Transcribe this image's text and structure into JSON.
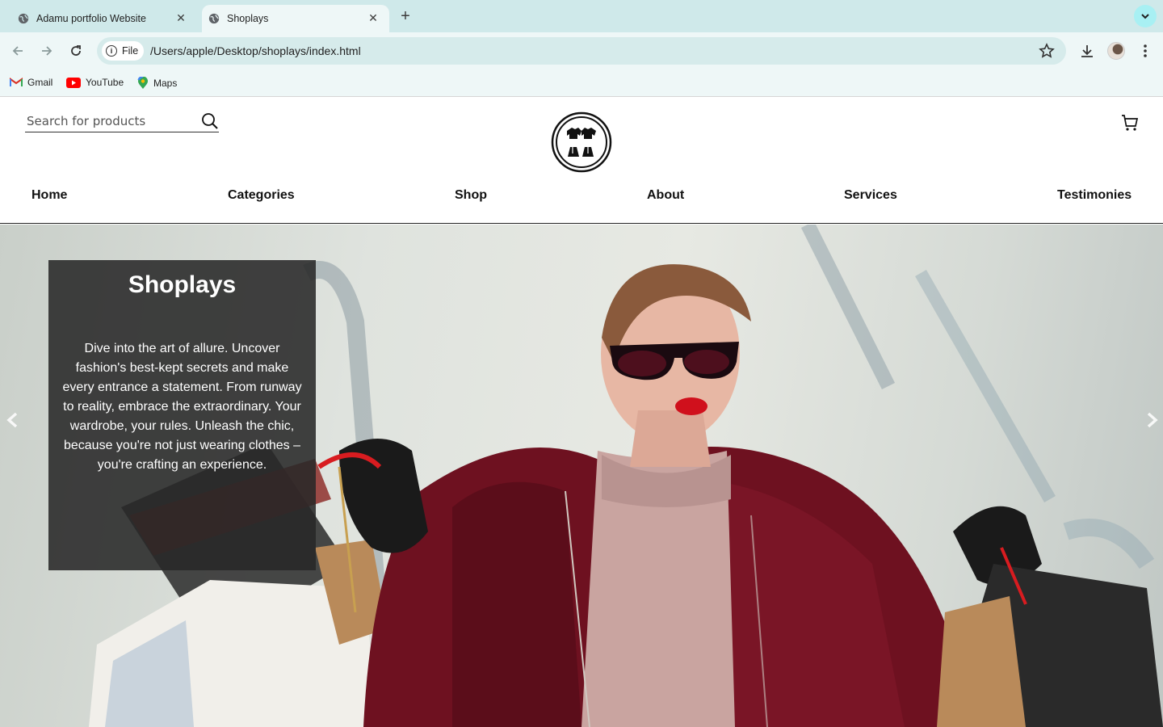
{
  "browser": {
    "tabs": [
      {
        "title": "Adamu portfolio Website"
      },
      {
        "title": "Shoplays"
      }
    ],
    "address": {
      "scheme_label": "File",
      "url": "/Users/apple/Desktop/shoplays/index.html"
    },
    "bookmarks": [
      {
        "label": "Gmail"
      },
      {
        "label": "YouTube"
      },
      {
        "label": "Maps"
      }
    ],
    "accent_color": "#cfe9ea"
  },
  "site": {
    "search": {
      "placeholder": "Search for products"
    },
    "nav": [
      {
        "label": "Home"
      },
      {
        "label": "Categories"
      },
      {
        "label": "Shop"
      },
      {
        "label": "About"
      },
      {
        "label": "Services"
      },
      {
        "label": "Testimonies"
      }
    ],
    "hero": {
      "title": "Shoplays",
      "text": "Dive into the art of allure. Uncover fashion's best-kept secrets and make every entrance a statement. From runway to reality, embrace the extraordinary. Your wardrobe, your rules. Unleash the chic, because you're not just wearing clothes – you're crafting an experience.",
      "caption_bg": "#2e2e2e"
    },
    "icons": [
      "search-icon",
      "cart-icon",
      "logo-icon",
      "prev-arrow-icon",
      "next-arrow-icon"
    ]
  }
}
